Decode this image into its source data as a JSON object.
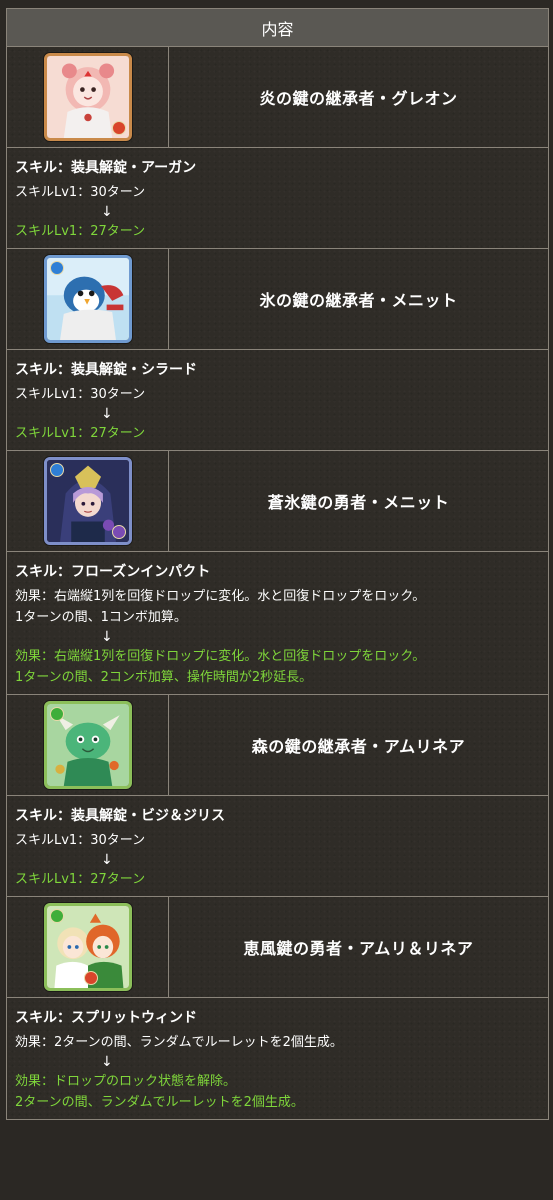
{
  "header": {
    "title": "内容"
  },
  "rows": [
    {
      "name": "炎の鍵の継承者・グレオン",
      "icon": "fire-lion-portrait-icon",
      "skill_title": "スキル：装具解錠・アーガン",
      "before": [
        "スキルLv1：30ターン"
      ],
      "arrow": "↓",
      "after": [
        "スキルLv1：27ターン"
      ]
    },
    {
      "name": "氷の鍵の継承者・メニット",
      "icon": "water-penguin-portrait-icon",
      "skill_title": "スキル：装具解錠・シラード",
      "before": [
        "スキルLv1：30ターン"
      ],
      "arrow": "↓",
      "after": [
        "スキルLv1：27ターン"
      ]
    },
    {
      "name": "蒼氷鍵の勇者・メニット",
      "icon": "water-dark-hero-portrait-icon",
      "skill_title": "スキル：フローズンインパクト",
      "before": [
        "効果：右端縦1列を回復ドロップに変化。水と回復ドロップをロック。",
        "1ターンの間、1コンボ加算。"
      ],
      "arrow": "↓",
      "after": [
        "効果：右端縦1列を回復ドロップに変化。水と回復ドロップをロック。",
        "1ターンの間、2コンボ加算、操作時間が2秒延長。"
      ]
    },
    {
      "name": "森の鍵の継承者・アムリネア",
      "icon": "wood-dragon-portrait-icon",
      "skill_title": "スキル：装具解錠・ビジ＆ジリス",
      "before": [
        "スキルLv1：30ターン"
      ],
      "arrow": "↓",
      "after": [
        "スキルLv1：27ターン"
      ]
    },
    {
      "name": "恵風鍵の勇者・アムリ＆リネア",
      "icon": "wood-fire-twins-portrait-icon",
      "skill_title": "スキル：スプリットウィンド",
      "before": [
        "効果：2ターンの間、ランダムでルーレットを2個生成。"
      ],
      "arrow": "↓",
      "after": [
        "効果：ドロップのロック状態を解除。",
        "2ターンの間、ランダムでルーレットを2個生成。"
      ]
    }
  ],
  "colors": {
    "upgrade_text": "#7fd63b",
    "fire": "#d9452b",
    "water": "#2f7fd6",
    "wood": "#3fae3a",
    "dark": "#7a4bb3"
  }
}
